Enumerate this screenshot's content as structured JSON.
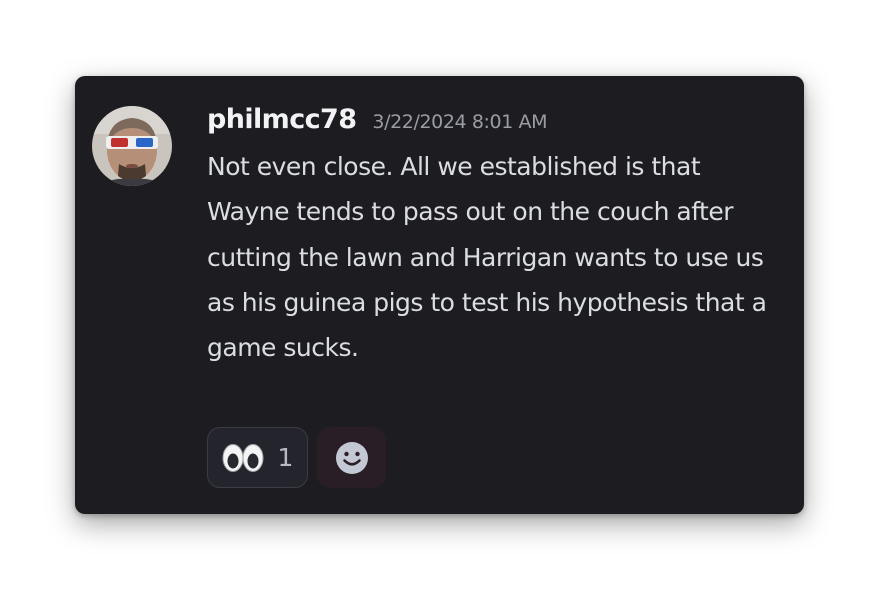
{
  "message": {
    "username": "philmcc78",
    "timestamp": "3/22/2024 8:01 AM",
    "text": "Not even close. All we established is that Wayne tends to pass out on the couch after cutting the lawn and Harrigan wants to use us as his guinea pigs to test his hypothesis that a game sucks.",
    "avatar_icon": "user-avatar-3d-glasses"
  },
  "reactions": [
    {
      "emoji_icon": "eyes-emoji-icon",
      "count": "1"
    }
  ],
  "add_reaction_icon": "smiley-face-icon",
  "colors": {
    "card_bg": "#1c1c21",
    "username": "#f2f3f5",
    "timestamp": "#9a9ca6",
    "text": "#dbdee1",
    "reaction_border": "#3b3c44",
    "add_reaction_bg": "#2a1e26"
  }
}
